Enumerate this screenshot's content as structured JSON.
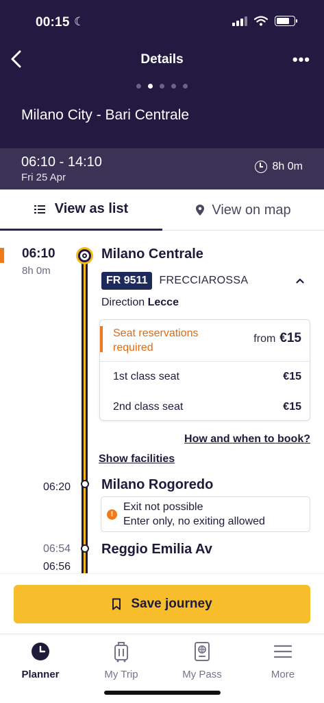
{
  "status": {
    "time": "00:15"
  },
  "nav": {
    "title": "Details",
    "page_count": 5,
    "active_page": 1
  },
  "route": {
    "title": "Milano City - Bari Centrale"
  },
  "summary": {
    "time_range": "06:10 - 14:10",
    "date": "Fri 25 Apr",
    "duration": "8h 0m"
  },
  "tabs": {
    "list": "View as list",
    "map": "View on map"
  },
  "departure": {
    "time": "06:10",
    "duration": "8h 0m",
    "station": "Milano Centrale",
    "train_number": "FR 9511",
    "train_name": "FRECCIAROSSA",
    "direction_label": "Direction",
    "direction_value": "Lecce"
  },
  "seats": {
    "required_text": "Seat reservations required",
    "from_label": "from",
    "from_price": "€15",
    "rows": [
      {
        "label": "1st class seat",
        "price": "€15"
      },
      {
        "label": "2nd class seat",
        "price": "€15"
      }
    ]
  },
  "links": {
    "how_to_book": "How and when to book?",
    "show_facilities": "Show facilities"
  },
  "stops": [
    {
      "time": "06:20",
      "name": "Milano Rogoredo"
    },
    {
      "time_arr": "06:54",
      "time_dep": "06:56",
      "name": "Reggio Emilia Av"
    }
  ],
  "warning": {
    "line1": "Exit not possible",
    "line2": "Enter only, no exiting allowed"
  },
  "save": {
    "label": "Save journey"
  },
  "tabbar": [
    {
      "label": "Planner",
      "icon": "clock-icon",
      "active": true
    },
    {
      "label": "My Trip",
      "icon": "luggage-icon",
      "active": false
    },
    {
      "label": "My Pass",
      "icon": "passport-icon",
      "active": false
    },
    {
      "label": "More",
      "icon": "menu-icon",
      "active": false
    }
  ],
  "colors": {
    "header": "#231a42",
    "accent": "#f7bd2b",
    "warning": "#f07a1a",
    "badge": "#1f2a5c"
  }
}
